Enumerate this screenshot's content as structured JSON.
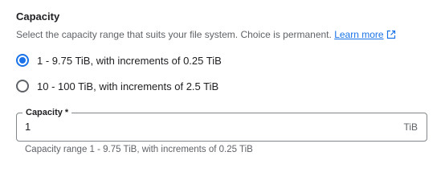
{
  "section": {
    "title": "Capacity",
    "description": "Select the capacity range that suits your file system. Choice is permanent.",
    "learn_more_label": "Learn more",
    "learn_more_icon": "external-link-icon",
    "accent_color": "#1a73e8"
  },
  "radio_options": [
    {
      "label": "1 - 9.75 TiB, with increments of 0.25 TiB",
      "selected": true
    },
    {
      "label": "10 - 100 TiB, with increments of 2.5 TiB",
      "selected": false
    }
  ],
  "capacity_field": {
    "label": "Capacity *",
    "value": "1",
    "suffix": "TiB",
    "helper": "Capacity range 1 - 9.75 TiB, with increments of 0.25 TiB"
  }
}
